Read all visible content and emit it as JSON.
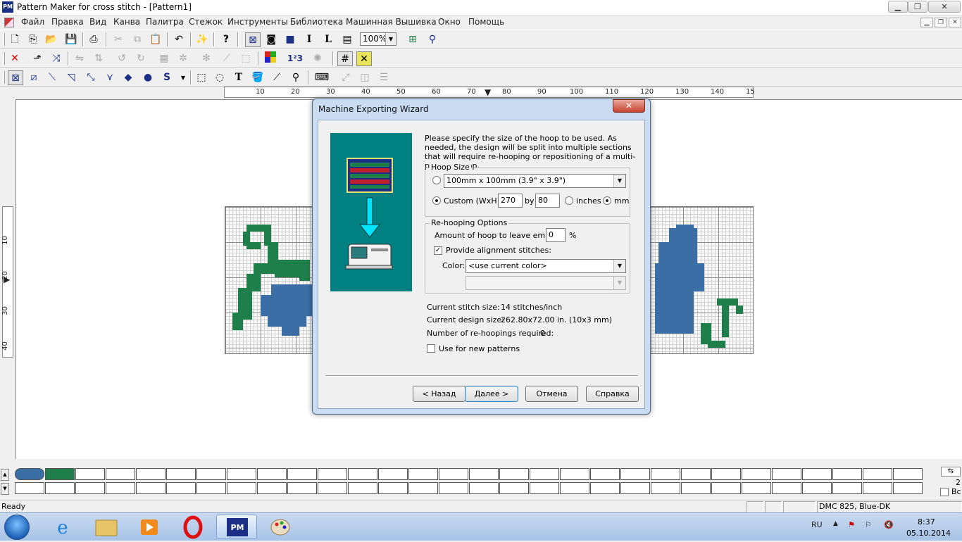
{
  "app": {
    "title": "Pattern Maker for cross stitch - [Pattern1]",
    "icon_label": "PM"
  },
  "window_controls": {
    "minimize": "▁",
    "maximize": "❐",
    "close": "✕"
  },
  "menu": {
    "items": [
      "Файл",
      "Правка",
      "Вид",
      "Канва",
      "Палитра",
      "Стежок",
      "Инструменты",
      "Библиотека",
      "Машинная Вышивка",
      "Окно",
      "Помощь"
    ],
    "mdi_controls": [
      "▁",
      "❐",
      "✕"
    ]
  },
  "toolbar": {
    "zoom_value": "100%",
    "zoom_arrow": "▼"
  },
  "ruler": {
    "horizontal_labels": [
      "10",
      "20",
      "30",
      "40",
      "50",
      "60",
      "70",
      "80",
      "90",
      "100",
      "110",
      "120",
      "130",
      "140",
      "15"
    ],
    "vertical_labels": [
      "10",
      "20",
      "30",
      "40"
    ]
  },
  "dialog": {
    "title": "Machine Exporting Wizard",
    "close_glyph": "✕",
    "intro": "Please specify the size of the hoop to be used.  As needed, the design will be split into multiple sections that will require re-hooping or repositioning of a multi-position hoop.",
    "hoop_size": {
      "label": "Hoop Size",
      "preset_value": "100mm x 100mm (3.9\" x 3.9\")",
      "custom_label": "Custom (WxH):",
      "width": "270",
      "by_label": "by",
      "height": "80",
      "inches_label": "inches",
      "mm_label": "mm",
      "selected_mode": "custom",
      "selected_unit": "mm"
    },
    "rehooping": {
      "label": "Re-hooping Options",
      "amount_label": "Amount of hoop to leave empty:",
      "amount_value": "0",
      "percent": "%",
      "alignment_label": "Provide alignment stitches:",
      "alignment_checked": true,
      "color_label": "Color:",
      "color_value": "<use current color>",
      "secondary_value": ""
    },
    "info": {
      "stitch_size_label": "Current stitch size:",
      "stitch_size_value": "14 stitches/inch",
      "design_size_label": "Current design size:",
      "design_size_value": "262.80x72.00 in.  (10x3 mm)",
      "rehoopings_label": "Number of re-hoopings required:",
      "rehoopings_value": "0"
    },
    "use_for_new_label": "Use for new patterns",
    "use_for_new_checked": false,
    "buttons": {
      "back": "< Назад",
      "next": "Далее >",
      "cancel": "Отмена",
      "help": "Справка"
    }
  },
  "palette": {
    "swatch_colors": [
      "#3a6ea5",
      "#1e7f4a"
    ],
    "right_labels": [
      "2",
      "Вс"
    ]
  },
  "status": {
    "text": "Ready",
    "color_info": "DMC  825, Blue-DK"
  },
  "taskbar": {
    "language": "RU",
    "time": "8:37",
    "date": "05.10.2014",
    "apps": [
      "windows-explorer",
      "internet-explorer",
      "file-explorer",
      "media-player",
      "opera",
      "pattern-maker",
      "paint"
    ]
  },
  "colors": {
    "thread_blue": "#3a6ea5",
    "thread_green": "#1e7f4a",
    "dialog_frame": "#c9dcf2",
    "wizard_art": "#008080"
  }
}
